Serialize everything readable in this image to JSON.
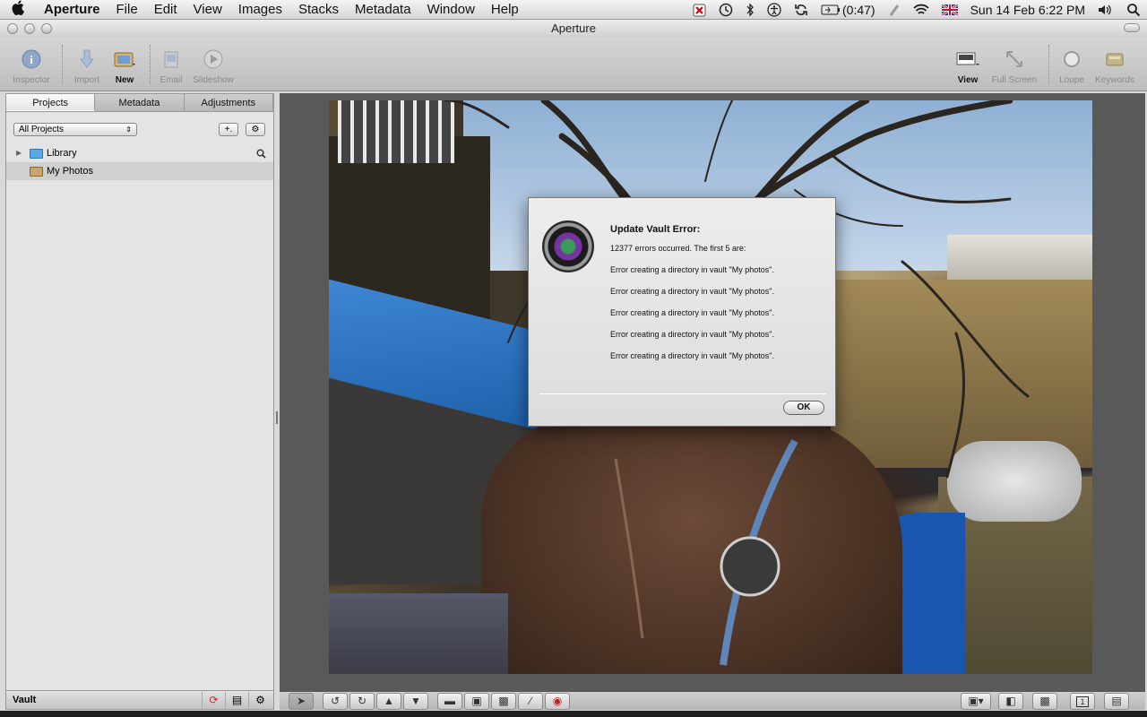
{
  "menubar": {
    "items": [
      "Aperture",
      "File",
      "Edit",
      "View",
      "Images",
      "Stacks",
      "Metadata",
      "Window",
      "Help"
    ],
    "battery": "(0:47)",
    "clock": "Sun 14 Feb  6:22 PM"
  },
  "window": {
    "title": "Aperture"
  },
  "toolbar": {
    "inspector": "Inspector",
    "import": "Import",
    "new": "New",
    "email": "Email",
    "slideshow": "Slideshow",
    "view": "View",
    "fullscreen": "Full Screen",
    "loupe": "Loupe",
    "keywords": "Keywords"
  },
  "sidebar": {
    "tabs": [
      "Projects",
      "Metadata",
      "Adjustments"
    ],
    "filter": "All Projects",
    "add_label": "+.",
    "items": [
      {
        "label": "Library"
      },
      {
        "label": "My Photos"
      }
    ],
    "footer": "Vault"
  },
  "dialog": {
    "title": "Update Vault Error:",
    "summary": "12377 errors occurred. The first 5 are:",
    "errors": [
      "Error creating a directory in vault \"My photos\".",
      "Error creating a directory in vault \"My photos\".",
      "Error creating a directory in vault \"My photos\".",
      "Error creating a directory in vault \"My photos\".",
      "Error creating a directory in vault \"My photos\"."
    ],
    "ok": "OK"
  },
  "bottombar": {
    "page_indicator": "1"
  },
  "colors": {
    "accent_blue": "#3b8ee0",
    "folder_blue": "#5aa9e6",
    "folder_brown": "#c8a46a"
  }
}
